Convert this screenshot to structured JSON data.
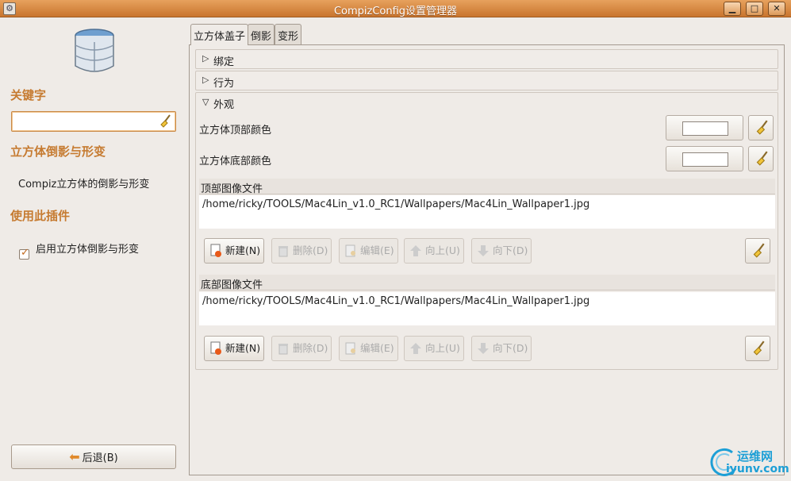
{
  "window": {
    "title": "CompizConfig设置管理器",
    "app_icon": "ccsm-app-icon"
  },
  "left": {
    "filter_heading": "关键字",
    "filter_value": "",
    "plugin_heading": "立方体倒影与形变",
    "plugin_description": "Compiz立方体的倒影与形变",
    "use_heading": "使用此插件",
    "enable_label": "启用立方体倒影与形变",
    "enable_checked": true,
    "back_label": "后退(B)"
  },
  "tabs": [
    {
      "label": "立方体盖子",
      "active": true
    },
    {
      "label": "倒影",
      "active": false
    },
    {
      "label": "变形",
      "active": false
    }
  ],
  "groups": {
    "bindings": "绑定",
    "behaviour": "行为",
    "appearance": "外观"
  },
  "appearance": {
    "top_color_label": "立方体顶部颜色",
    "top_color": "#ffffff",
    "bottom_color_label": "立方体底部颜色",
    "bottom_color": "#ffffff",
    "top_images_label": "顶部图像文件",
    "top_images": [
      "/home/ricky/TOOLS/Mac4Lin_v1.0_RC1/Wallpapers/Mac4Lin_Wallpaper1.jpg"
    ],
    "bottom_images_label": "底部图像文件",
    "bottom_images": [
      "/home/ricky/TOOLS/Mac4Lin_v1.0_RC1/Wallpapers/Mac4Lin_Wallpaper1.jpg"
    ]
  },
  "actions": {
    "new": "新建(N)",
    "delete": "删除(D)",
    "edit": "编辑(E)",
    "up": "向上(U)",
    "down": "向下(D)"
  },
  "watermark": {
    "line1": "运维网",
    "line2": "iyunv.com"
  },
  "colors": {
    "accent": "#c67b31",
    "titlebar": "#d88a44"
  }
}
